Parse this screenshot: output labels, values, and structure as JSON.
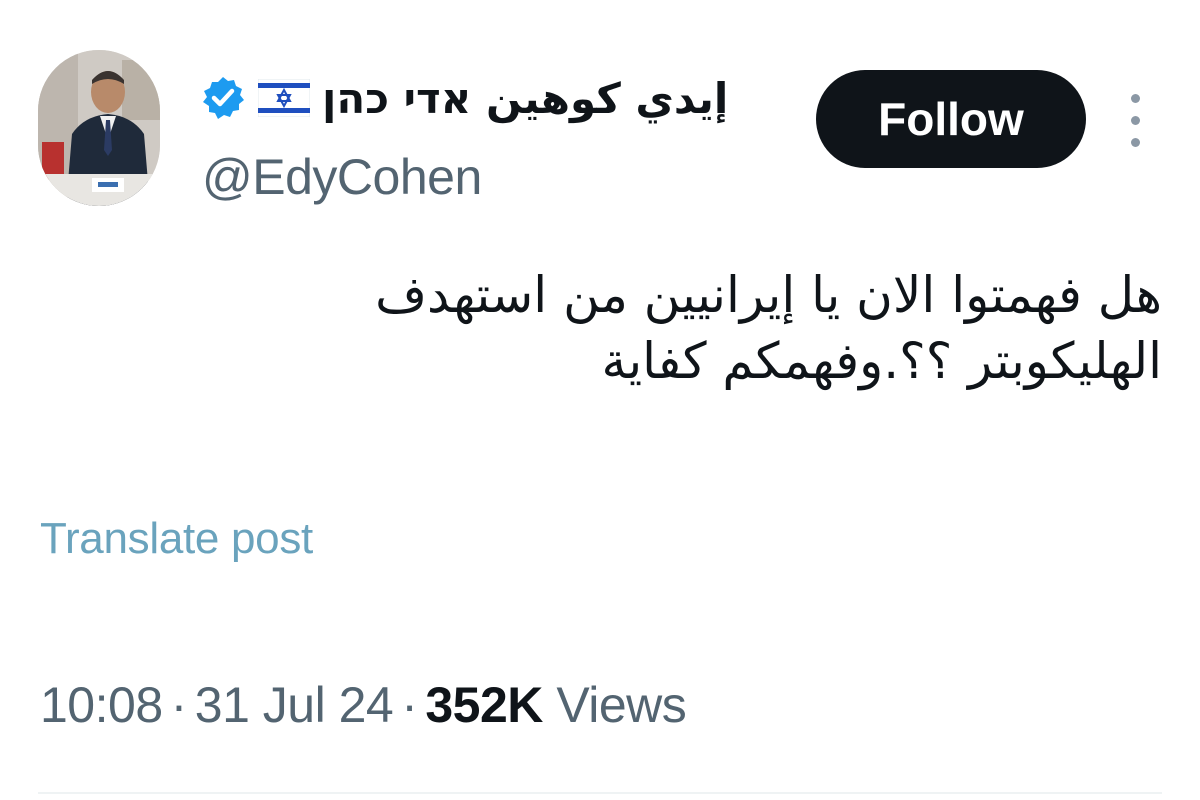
{
  "author": {
    "display_name": "إيدي كوهين אדי כהן",
    "handle": "@EdyCohen",
    "verified_icon": "verified-badge-icon",
    "flag_icon": "israel-flag-icon"
  },
  "follow_button": {
    "label": "Follow"
  },
  "more_menu": {
    "icon": "more-options-icon"
  },
  "tweet": {
    "lines": [
      "هل فهمتوا الان يا إيرانيين من استهدف",
      "الهليكوبتر ؟؟.وفهمكم كفاية"
    ]
  },
  "translate": {
    "label": "Translate post"
  },
  "meta": {
    "time": "10:08",
    "date": "31 Jul 24",
    "views_count": "352K",
    "views_label": "Views",
    "separator": "·"
  },
  "colors": {
    "text_primary": "#0f1419",
    "text_secondary": "#536471",
    "link": "#6aa3bd",
    "button_bg": "#0f1419",
    "verified": "#1d9bf0"
  }
}
